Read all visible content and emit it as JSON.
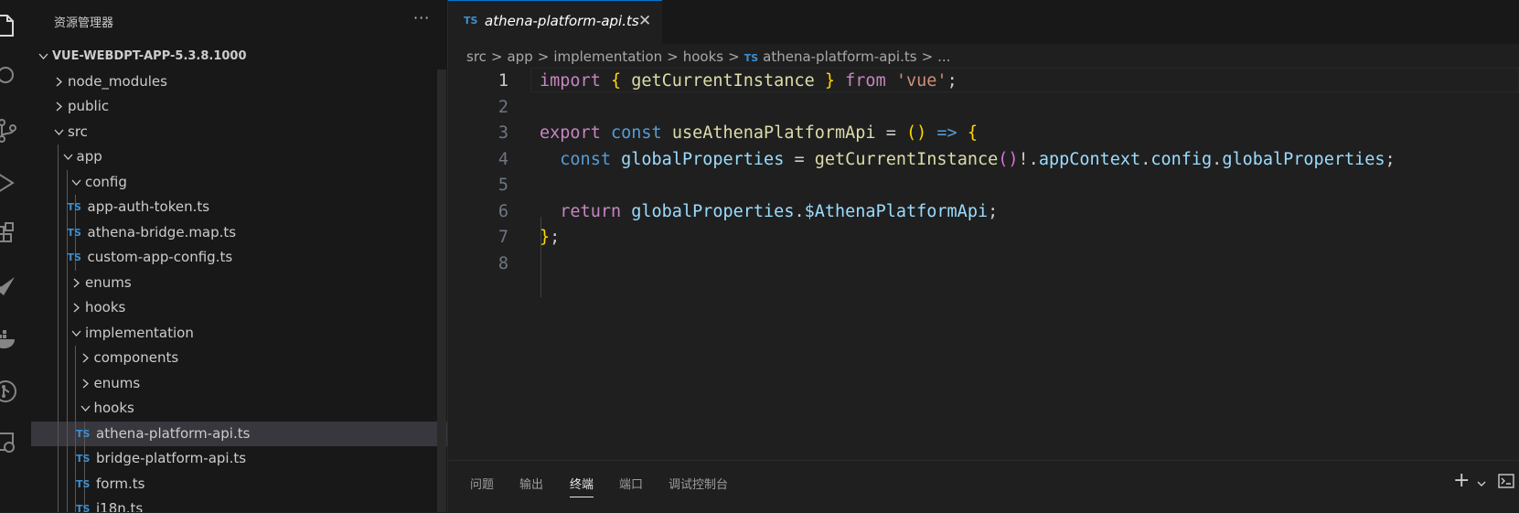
{
  "activity_bar": {
    "icons": [
      "explorer-icon",
      "search-icon",
      "source-control-icon",
      "run-debug-icon",
      "extensions-icon",
      "remote-icon",
      "docker-icon",
      "git-graph-icon",
      "remote-explorer-icon"
    ]
  },
  "explorer": {
    "title": "资源管理器",
    "more_label": "···",
    "root": "VUE-WEBDPT-APP-5.3.8.1000",
    "ts_badge": "TS",
    "items": [
      {
        "label": "node_modules",
        "type": "folder",
        "expanded": false,
        "depth": 1
      },
      {
        "label": "public",
        "type": "folder",
        "expanded": false,
        "depth": 1
      },
      {
        "label": "src",
        "type": "folder",
        "expanded": true,
        "depth": 1
      },
      {
        "label": "app",
        "type": "folder",
        "expanded": true,
        "depth": 2
      },
      {
        "label": "config",
        "type": "folder",
        "expanded": true,
        "depth": 3
      },
      {
        "label": "app-auth-token.ts",
        "type": "file",
        "depth": 4
      },
      {
        "label": "athena-bridge.map.ts",
        "type": "file",
        "depth": 4
      },
      {
        "label": "custom-app-config.ts",
        "type": "file",
        "depth": 4
      },
      {
        "label": "enums",
        "type": "folder",
        "expanded": false,
        "depth": 3
      },
      {
        "label": "hooks",
        "type": "folder",
        "expanded": false,
        "depth": 3
      },
      {
        "label": "implementation",
        "type": "folder",
        "expanded": true,
        "depth": 3
      },
      {
        "label": "components",
        "type": "folder",
        "expanded": false,
        "depth": 4
      },
      {
        "label": "enums",
        "type": "folder",
        "expanded": false,
        "depth": 4
      },
      {
        "label": "hooks",
        "type": "folder",
        "expanded": true,
        "depth": 4
      },
      {
        "label": "athena-platform-api.ts",
        "type": "file",
        "depth": 5,
        "selected": true
      },
      {
        "label": "bridge-platform-api.ts",
        "type": "file",
        "depth": 5
      },
      {
        "label": "form.ts",
        "type": "file",
        "depth": 5
      },
      {
        "label": "i18n.ts",
        "type": "file",
        "depth": 5
      }
    ]
  },
  "editor": {
    "tab": {
      "badge": "TS",
      "label": "athena-platform-api.ts",
      "close": "✕"
    },
    "breadcrumb": [
      "src",
      "app",
      "implementation",
      "hooks",
      "athena-platform-api.ts",
      "..."
    ],
    "breadcrumb_sep": ">",
    "active_line": 1,
    "lines": [
      {
        "n": "1",
        "tokens": [
          [
            "kw",
            "import"
          ],
          [
            "pn",
            " "
          ],
          [
            "br1",
            "{"
          ],
          [
            "pn",
            " "
          ],
          [
            "fn",
            "getCurrentInstance"
          ],
          [
            "pn",
            " "
          ],
          [
            "br1",
            "}"
          ],
          [
            "pn",
            " "
          ],
          [
            "kw",
            "from"
          ],
          [
            "pn",
            " "
          ],
          [
            "str",
            "'vue'"
          ],
          [
            "pn",
            ";"
          ]
        ]
      },
      {
        "n": "2",
        "tokens": []
      },
      {
        "n": "3",
        "tokens": [
          [
            "kw",
            "export"
          ],
          [
            "pn",
            " "
          ],
          [
            "kb",
            "const"
          ],
          [
            "pn",
            " "
          ],
          [
            "fn",
            "useAthenaPlatformApi"
          ],
          [
            "pn",
            " = "
          ],
          [
            "br1",
            "()"
          ],
          [
            "pn",
            " "
          ],
          [
            "kb",
            "=>"
          ],
          [
            "pn",
            " "
          ],
          [
            "br1",
            "{"
          ]
        ]
      },
      {
        "n": "4",
        "tokens": [
          [
            "pn",
            "  "
          ],
          [
            "kb",
            "const"
          ],
          [
            "pn",
            " "
          ],
          [
            "var",
            "globalProperties"
          ],
          [
            "pn",
            " = "
          ],
          [
            "fn",
            "getCurrentInstance"
          ],
          [
            "br2",
            "()"
          ],
          [
            "pn",
            "!."
          ],
          [
            "var",
            "appContext"
          ],
          [
            "pn",
            "."
          ],
          [
            "var",
            "config"
          ],
          [
            "pn",
            "."
          ],
          [
            "var",
            "globalProperties"
          ],
          [
            "pn",
            ";"
          ]
        ]
      },
      {
        "n": "5",
        "tokens": []
      },
      {
        "n": "6",
        "tokens": [
          [
            "pn",
            "  "
          ],
          [
            "kw",
            "return"
          ],
          [
            "pn",
            " "
          ],
          [
            "var",
            "globalProperties"
          ],
          [
            "pn",
            "."
          ],
          [
            "var",
            "$AthenaPlatformApi"
          ],
          [
            "pn",
            ";"
          ]
        ]
      },
      {
        "n": "7",
        "tokens": [
          [
            "br1",
            "}"
          ],
          [
            "pn",
            ";"
          ]
        ]
      },
      {
        "n": "8",
        "tokens": []
      }
    ]
  },
  "panel": {
    "tabs": [
      {
        "label": "问题",
        "active": false
      },
      {
        "label": "输出",
        "active": false
      },
      {
        "label": "终端",
        "active": true
      },
      {
        "label": "端口",
        "active": false
      },
      {
        "label": "调试控制台",
        "active": false
      }
    ],
    "plus": "+"
  }
}
